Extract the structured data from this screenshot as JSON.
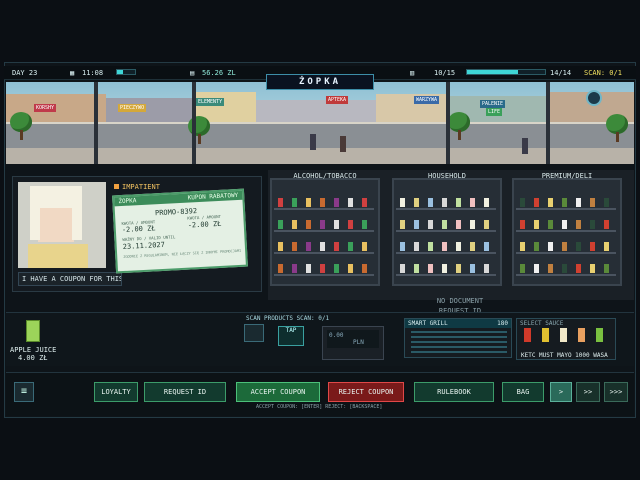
{
  "hud": {
    "day": "DAY 23",
    "time": "11:08",
    "time_fraction": 0.35,
    "money": "56.26 ZL",
    "queue": "10/15",
    "queue_fraction": 0.66,
    "ratio": "14/14",
    "scan": "SCAN: 0/1"
  },
  "store": {
    "logo": "ŻOPKA"
  },
  "street_signs": [
    "KORSHY",
    "PIECZYWO",
    "ELEMENTY",
    "APTEKA",
    "WARZYWA",
    "PALENIE",
    "LIFE"
  ],
  "customer": {
    "status": "IMPATIENT",
    "speech": "I HAVE A COUPON FOR THIS"
  },
  "coupon": {
    "brand": "ŻOPKA",
    "title": "KUPON RABATOWY",
    "code": "PROMO-8392",
    "amount_label_1": "KWOTA / AMOUNT",
    "amount_1": "-2.00 ZŁ",
    "amount_label_2": "KWOTA / AMOUNT",
    "amount_2": "-2.00 ZŁ",
    "valid_label": "WAŻNY DO / VALID UNTIL",
    "valid_date": "23.11.2027",
    "fine_print": "ZGODNIE Z REGULAMINEM, NIE ŁĄCZY SIĘ Z INNYMI PROMOCJAMI"
  },
  "shelves": {
    "headers": [
      "ALCOHOL/TOBACCO",
      "HOUSEHOLD",
      "PREMIUM/DELI"
    ],
    "no_document": "NO DOCUMENT",
    "request_id": "REQUEST ID"
  },
  "item": {
    "name": "APPLE JUICE",
    "price": "4.00 ZŁ"
  },
  "scan_area": {
    "label": "SCAN PRODUCTS SCAN: 0/1",
    "tap": "TAP",
    "amount": "0.00",
    "currency": "PLN"
  },
  "grill": {
    "title": "SMART GRILL",
    "temp": "180"
  },
  "sauce": {
    "title": "SELECT SAUCE",
    "names": "KETC MUST MAYO 1000 WASA"
  },
  "buttons": {
    "loyalty": "LOYALTY",
    "request_id": "REQUEST ID",
    "accept": "ACCEPT COUPON",
    "reject": "REJECT COUPON",
    "rulebook": "RULEBOOK",
    "bag": "BAG",
    "next1": ">",
    "next2": ">>",
    "next3": ">>>"
  },
  "hint": "ACCEPT COUPON: [ENTER]   REJECT: [BACKSPACE]",
  "colors": {
    "accent": "#3fd6d6",
    "accept": "#3c8c5a",
    "reject": "#c03a3a",
    "status": "#f0a040"
  }
}
